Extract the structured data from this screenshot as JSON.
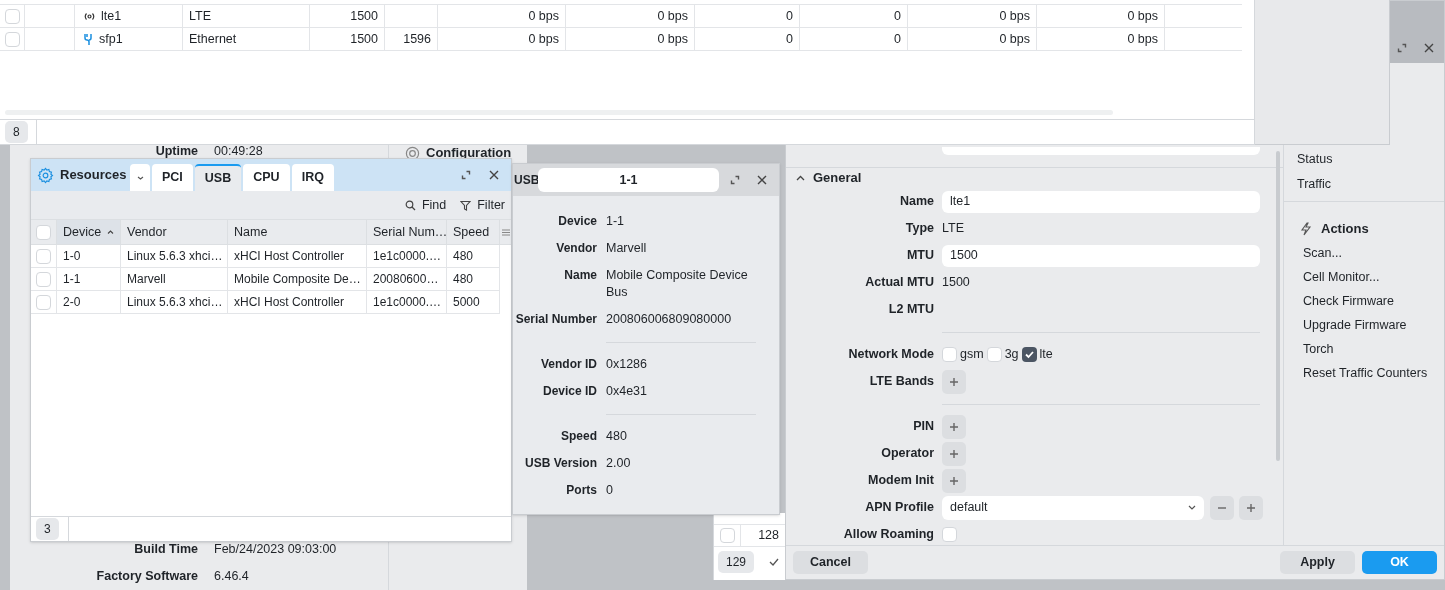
{
  "interfaces_table": {
    "rows": [
      {
        "checked": false,
        "kind": "lte",
        "name": "lte1",
        "cells": [
          "LTE",
          "1500",
          null,
          "0 bps",
          "0 bps",
          "0",
          "0",
          "0 bps",
          "0 bps"
        ]
      },
      {
        "checked": false,
        "kind": "ethernet",
        "name": "sfp1",
        "cells": [
          "Ethernet",
          "1500",
          "1596",
          "0 bps",
          "0 bps",
          "0",
          "0",
          "0 bps",
          "0 bps"
        ]
      }
    ],
    "count": "8"
  },
  "system_panel": {
    "top_fields": [
      {
        "label": "Uptime",
        "value": "00:49:28"
      }
    ],
    "bottom_fields": [
      {
        "label": "Build Time",
        "value": "Feb/24/2023 09:03:00"
      },
      {
        "label": "Factory Software",
        "value": "6.46.4"
      }
    ]
  },
  "configuration_panel": {
    "title": "Configuration"
  },
  "lease_table": {
    "rows": [
      {
        "checked": false,
        "cell": "128"
      }
    ],
    "count": "129"
  },
  "lte_window": {
    "section": {
      "title": "General",
      "expanded": true
    },
    "fields": [
      {
        "kind": "input",
        "label": "Name",
        "value": "lte1"
      },
      {
        "kind": "text",
        "label": "Type",
        "value": "LTE"
      },
      {
        "kind": "input",
        "label": "MTU",
        "value": "1500"
      },
      {
        "kind": "text",
        "label": "Actual MTU",
        "value": "1500"
      },
      {
        "kind": "text",
        "label": "L2 MTU"
      },
      {
        "kind": "divider"
      },
      {
        "kind": "checks",
        "label": "Network Mode",
        "options": [
          {
            "label": "gsm",
            "checked": false
          },
          {
            "label": "3g",
            "checked": false
          },
          {
            "label": "lte",
            "checked": true
          }
        ]
      },
      {
        "kind": "add",
        "label": "LTE Bands"
      },
      {
        "kind": "divider"
      },
      {
        "kind": "add",
        "label": "PIN"
      },
      {
        "kind": "add",
        "label": "Operator"
      },
      {
        "kind": "add",
        "label": "Modem Init"
      },
      {
        "kind": "select",
        "label": "APN Profile",
        "value": "default"
      },
      {
        "kind": "checkbox",
        "label": "Allow Roaming",
        "checked": false
      }
    ],
    "sidebar": {
      "links": [
        "Status",
        "Traffic"
      ],
      "actions_title": "Actions",
      "actions": [
        "Scan...",
        "Cell Monitor...",
        "Check Firmware",
        "Upgrade Firmware",
        "Torch",
        "Reset Traffic Counters"
      ]
    },
    "buttons": [
      {
        "label": "Cancel",
        "kind": "secondary"
      },
      {
        "label": "Apply",
        "kind": "secondary"
      },
      {
        "label": "OK",
        "kind": "primary"
      }
    ]
  },
  "resources_window": {
    "title": "Resources",
    "tabs": [
      {
        "label": "PCI",
        "selected": false
      },
      {
        "label": "USB",
        "selected": true
      },
      {
        "label": "CPU",
        "selected": false
      },
      {
        "label": "IRQ",
        "selected": false
      }
    ],
    "toolbar": [
      "Find",
      "Filter"
    ],
    "header_checked": false,
    "columns": [
      {
        "label": "Device",
        "sorted": true
      },
      {
        "label": "Vendor",
        "sorted": false
      },
      {
        "label": "Name",
        "sorted": false
      },
      {
        "label": "Serial Num…",
        "sorted": false
      },
      {
        "label": "Speed",
        "sorted": false
      }
    ],
    "rows": [
      {
        "checked": false,
        "cells": [
          "1-0",
          "Linux 5.6.3 xhci…",
          "xHCI Host Controller",
          "1e1c0000.…",
          "480"
        ]
      },
      {
        "checked": false,
        "cells": [
          "1-1",
          "Marvell",
          "Mobile Composite De…",
          "20080600…",
          "480"
        ]
      },
      {
        "checked": false,
        "cells": [
          "2-0",
          "Linux 5.6.3 xhci…",
          "xHCI Host Controller",
          "1e1c0000.…",
          "5000"
        ]
      }
    ],
    "count": "3"
  },
  "usb_window": {
    "title": "USB",
    "tab": "1-1",
    "groups": [
      {
        "fields": [
          {
            "label": "Device",
            "value": "1-1"
          },
          {
            "label": "Vendor",
            "value": "Marvell"
          },
          {
            "label": "Name",
            "value": "Mobile Composite Device Bus"
          },
          {
            "label": "Serial Number",
            "value": "200806006809080000"
          }
        ]
      },
      {
        "fields": [
          {
            "label": "Vendor ID",
            "value": "0x1286"
          },
          {
            "label": "Device ID",
            "value": "0x4e31"
          }
        ]
      },
      {
        "fields": [
          {
            "label": "Speed",
            "value": "480"
          },
          {
            "label": "USB Version",
            "value": "2.00"
          },
          {
            "label": "Ports",
            "value": "0"
          }
        ]
      }
    ]
  }
}
